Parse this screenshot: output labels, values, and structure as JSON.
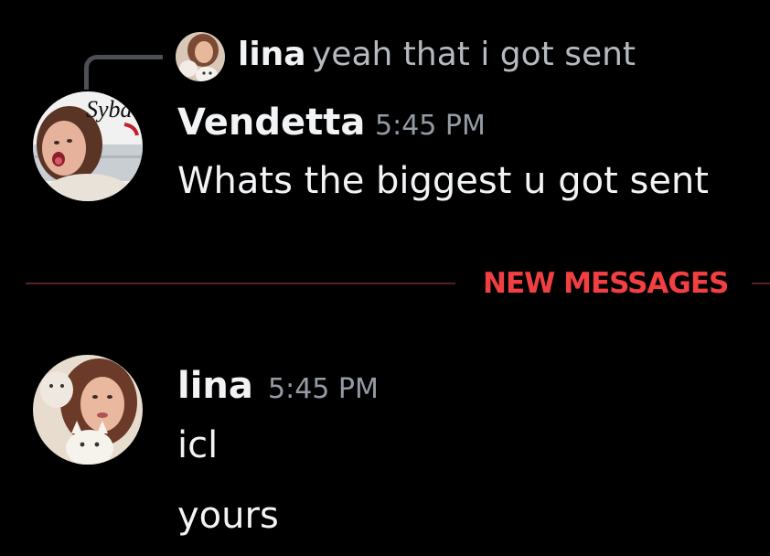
{
  "reply": {
    "author": "lina",
    "text": "yeah that i got sent"
  },
  "messages": [
    {
      "author": "Vendetta",
      "time": "5:45 PM",
      "avatar_text": "Sybau",
      "lines": [
        "Whats the biggest u got sent"
      ]
    },
    {
      "author": "lina",
      "time": "5:45 PM",
      "lines": [
        "icl",
        "yours"
      ]
    }
  ],
  "divider": {
    "label": "NEW MESSAGES",
    "color": "#f23f42"
  },
  "colors": {
    "background": "#000000",
    "text_primary": "#f2f3f5",
    "text_muted": "#949ba4",
    "reply_text": "#b5bac1"
  }
}
